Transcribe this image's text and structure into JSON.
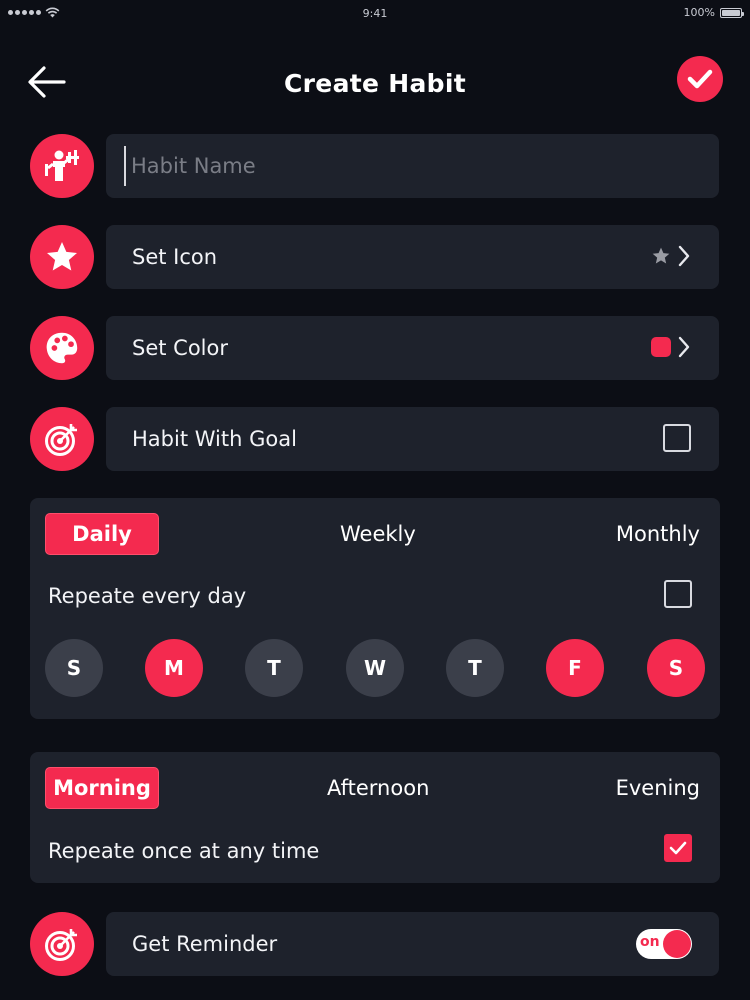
{
  "status_bar": {
    "time": "9:41",
    "battery": "100%"
  },
  "header": {
    "title": "Create Habit",
    "back_icon": "arrow-left-icon",
    "confirm_icon": "check-icon"
  },
  "habit_name": {
    "placeholder": "Habit Name",
    "value": "",
    "icon": "fitness-person-icon"
  },
  "set_icon": {
    "label": "Set Icon",
    "icon": "star-icon",
    "preview_icon": "star-icon"
  },
  "set_color": {
    "label": "Set Color",
    "icon": "palette-icon",
    "swatch_color": "#f42a4f"
  },
  "goal": {
    "label": "Habit With Goal",
    "icon": "target-icon",
    "checked": false
  },
  "frequency": {
    "tabs": [
      "Daily",
      "Weekly",
      "Monthly"
    ],
    "active_tab": "Daily",
    "repeat_label": "Repeate every day",
    "repeat_checked": false,
    "days": [
      {
        "label": "S",
        "active": false
      },
      {
        "label": "M",
        "active": true
      },
      {
        "label": "T",
        "active": false
      },
      {
        "label": "W",
        "active": false
      },
      {
        "label": "T",
        "active": false
      },
      {
        "label": "F",
        "active": true
      },
      {
        "label": "S",
        "active": true
      }
    ]
  },
  "time_of_day": {
    "tabs": [
      "Morning",
      "Afternoon",
      "Evening"
    ],
    "active_tab": "Morning",
    "repeat_label": "Repeate once at any time",
    "repeat_checked": true
  },
  "reminder": {
    "label": "Get Reminder",
    "icon": "target-icon",
    "toggle_text": "on",
    "enabled": true
  },
  "colors": {
    "background": "#0c0e15",
    "card": "#1e222c",
    "accent": "#f42a4f",
    "inactive_day": "#3b3f4a"
  }
}
